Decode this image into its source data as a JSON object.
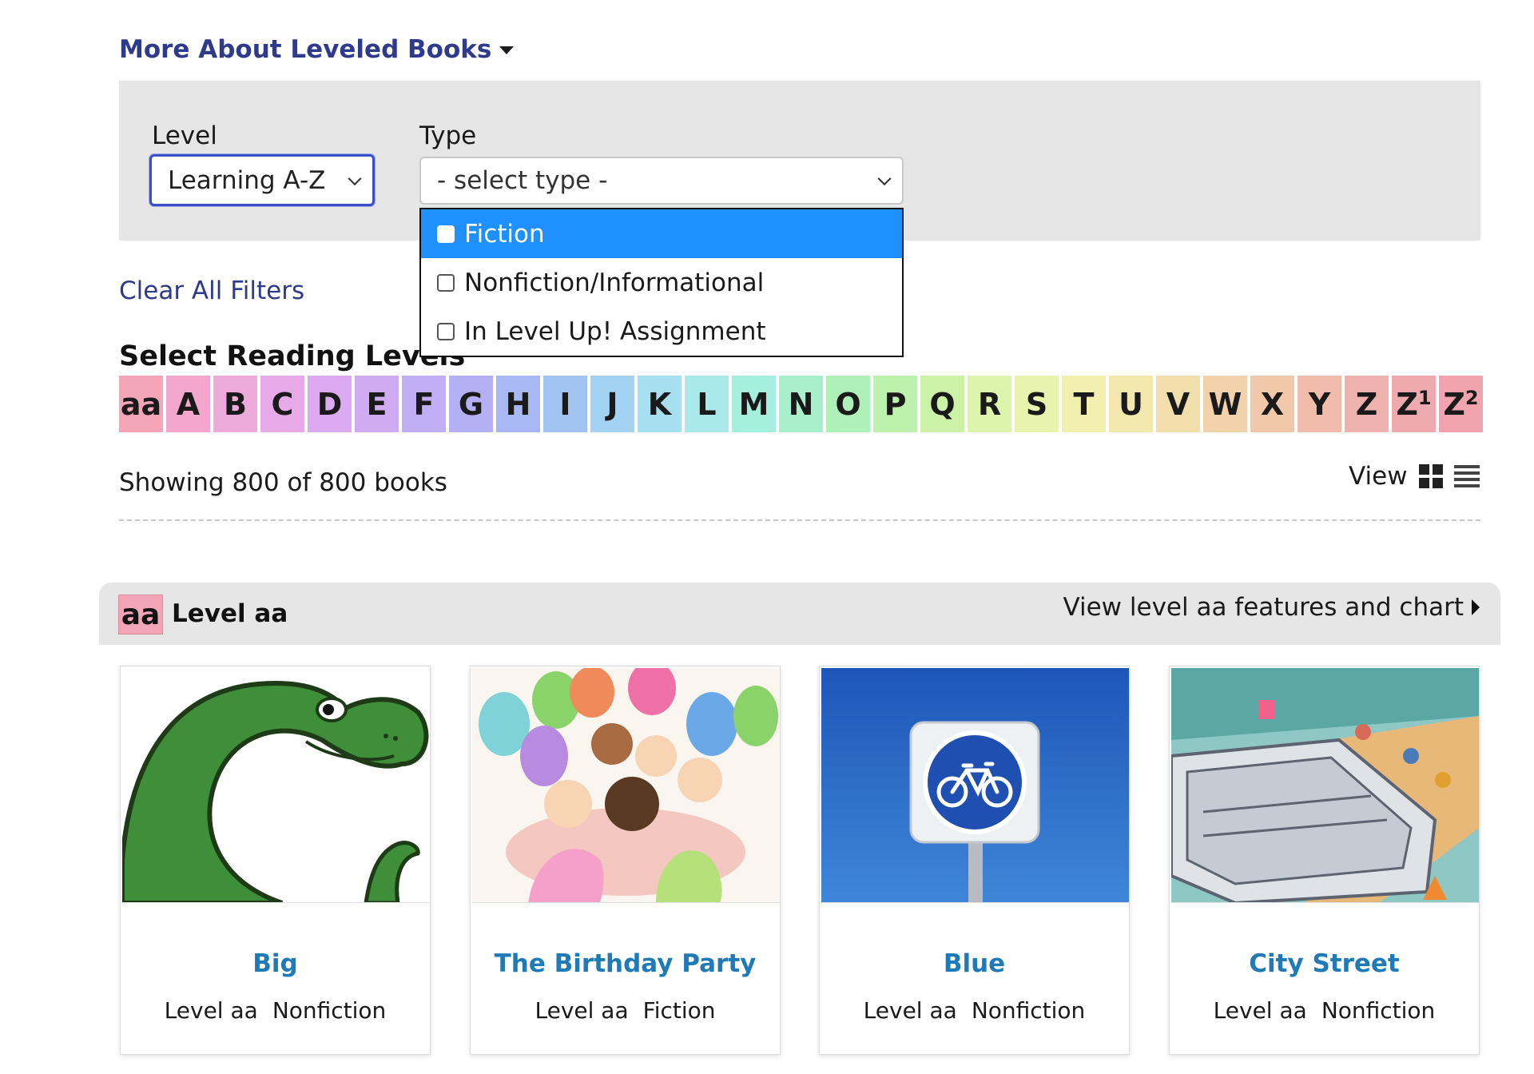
{
  "header": {
    "more_about": "More About Leveled Books"
  },
  "filters": {
    "level_label": "Level",
    "level_value": "Learning A-Z",
    "type_label": "Type",
    "type_value": "- select type -",
    "type_options": [
      "Fiction",
      "Nonfiction/Informational",
      "In Level Up! Assignment"
    ],
    "clear_all": "Clear All Filters"
  },
  "reading_levels": {
    "heading": "Select Reading Levels",
    "levels": [
      {
        "label": "aa",
        "color": "#f4a6b8"
      },
      {
        "label": "A",
        "color": "#f3a7cc"
      },
      {
        "label": "B",
        "color": "#eeaadb"
      },
      {
        "label": "C",
        "color": "#e7a9e8"
      },
      {
        "label": "D",
        "color": "#dcaaf0"
      },
      {
        "label": "E",
        "color": "#d0abf2"
      },
      {
        "label": "F",
        "color": "#c2aef4"
      },
      {
        "label": "G",
        "color": "#b4b0f4"
      },
      {
        "label": "H",
        "color": "#a8b8f4"
      },
      {
        "label": "I",
        "color": "#a2c4f2"
      },
      {
        "label": "J",
        "color": "#a3d2f2"
      },
      {
        "label": "K",
        "color": "#a6dff0"
      },
      {
        "label": "L",
        "color": "#a9e9ec"
      },
      {
        "label": "M",
        "color": "#a6eedd"
      },
      {
        "label": "N",
        "color": "#a8f0cc"
      },
      {
        "label": "O",
        "color": "#aef0b8"
      },
      {
        "label": "P",
        "color": "#bcf2ac"
      },
      {
        "label": "Q",
        "color": "#ccf2a8"
      },
      {
        "label": "R",
        "color": "#dcf4ac"
      },
      {
        "label": "S",
        "color": "#e8f4ae"
      },
      {
        "label": "T",
        "color": "#f1f0ae"
      },
      {
        "label": "U",
        "color": "#f2e7ac"
      },
      {
        "label": "V",
        "color": "#f1deaa"
      },
      {
        "label": "W",
        "color": "#f2d2aa"
      },
      {
        "label": "X",
        "color": "#f1c8aa"
      },
      {
        "label": "Y",
        "color": "#f1bcac"
      },
      {
        "label": "Z",
        "color": "#f0b2ae"
      },
      {
        "label": "Z",
        "sup": "1",
        "color": "#eeaaae"
      },
      {
        "label": "Z",
        "sup": "2",
        "color": "#f1a4ad"
      }
    ]
  },
  "results": {
    "showing": "Showing 800 of 800 books",
    "view_label": "View"
  },
  "level_section": {
    "badge": "aa",
    "title": "Level aa",
    "link": "View level aa features and chart"
  },
  "books": [
    {
      "title": "Big",
      "level": "Level aa",
      "type": "Nonfiction"
    },
    {
      "title": "The Birthday Party",
      "level": "Level aa",
      "type": "Fiction"
    },
    {
      "title": "Blue",
      "level": "Level aa",
      "type": "Nonfiction"
    },
    {
      "title": "City Street",
      "level": "Level aa",
      "type": "Nonfiction"
    }
  ]
}
